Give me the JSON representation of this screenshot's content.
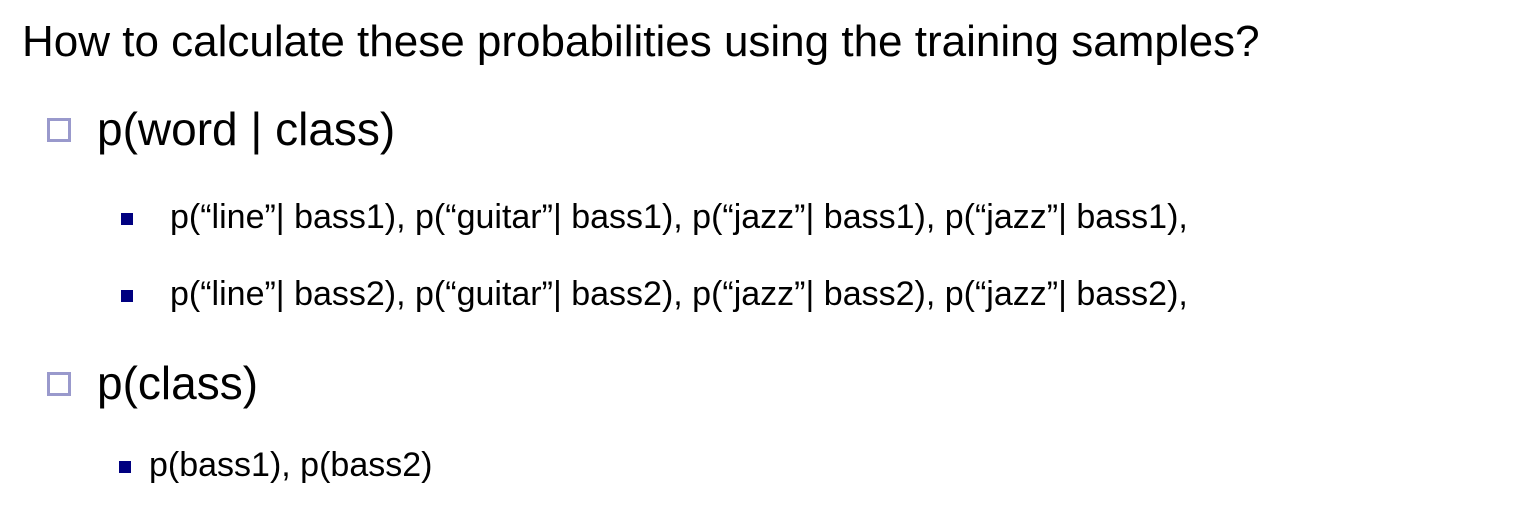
{
  "title": "How to calculate these probabilities using the training samples?",
  "bullet_colors": {
    "level1_hollow": "#9999cc",
    "level2_filled": "#000080"
  },
  "items": [
    {
      "label": "p(word | class)",
      "subitems": [
        "p(“line”| bass1), p(“guitar”| bass1), p(“jazz”| bass1), p(“jazz”| bass1),",
        "p(“line”| bass2), p(“guitar”| bass2), p(“jazz”| bass2), p(“jazz”| bass2),"
      ]
    },
    {
      "label": "p(class)",
      "subitems": [
        "p(bass1), p(bass2)"
      ]
    }
  ]
}
